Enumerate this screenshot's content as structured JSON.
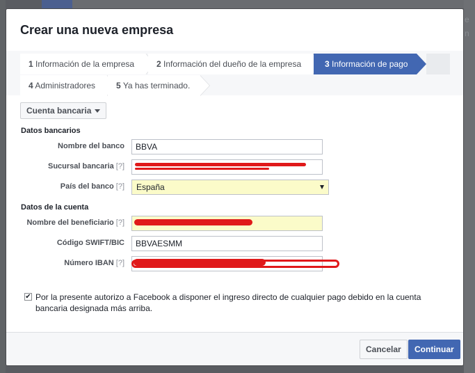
{
  "background": {
    "right_text": "e\nn"
  },
  "dialog": {
    "title": "Crear una nueva empresa"
  },
  "steps": [
    {
      "num": "1",
      "label": "Información de la empresa"
    },
    {
      "num": "2",
      "label": "Información del dueño de la empresa"
    },
    {
      "num": "3",
      "label": "Información de pago"
    },
    {
      "num": "4",
      "label": "Administradores"
    },
    {
      "num": "5",
      "label": "Ya has terminado."
    }
  ],
  "account_type": {
    "label": "Cuenta bancaria"
  },
  "bank_section": {
    "title": "Datos bancarios",
    "bank_name_label": "Nombre del banco",
    "bank_name_value": "BBVA",
    "branch_label": "Sucursal bancaria",
    "country_label": "País del banco",
    "country_value": "España"
  },
  "account_section": {
    "title": "Datos de la cuenta",
    "beneficiary_label": "Nombre del beneficiario",
    "swift_label": "Código SWIFT/BIC",
    "swift_value": "BBVAESMM",
    "iban_label": "Número IBAN"
  },
  "help_marker": "[?]",
  "consent": {
    "checked": true,
    "text": "Por la presente autorizo a Facebook a disponer el ingreso directo de cualquier pago debido en la cuenta bancaria designada más arriba."
  },
  "footer": {
    "cancel_label": "Cancelar",
    "continue_label": "Continuar"
  },
  "colors": {
    "accent": "#4267b2",
    "redaction": "#e0191a",
    "autofill": "#fbfbc9"
  }
}
